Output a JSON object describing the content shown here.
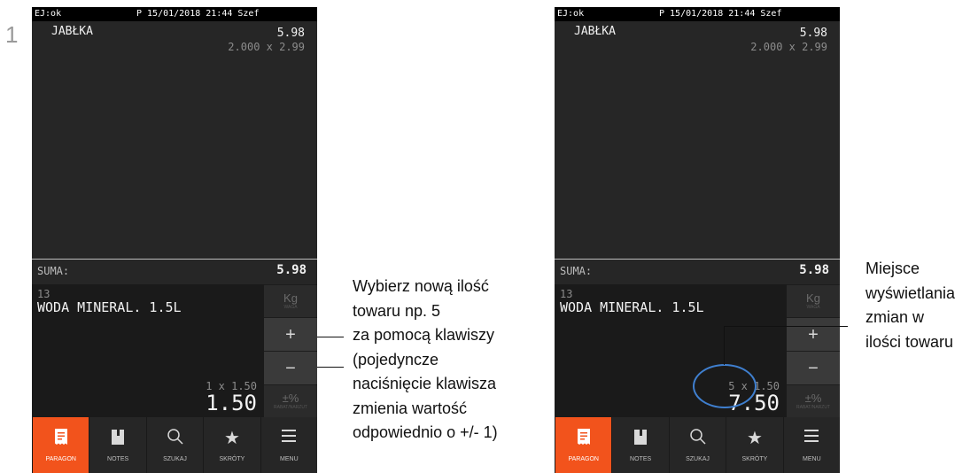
{
  "step_number": "1",
  "device": {
    "status_ej": "EJ:ok",
    "status_info": "P 15/01/2018 21:44 Szef",
    "receipt_item_name": "JABŁKA",
    "receipt_item_total": "5.98",
    "receipt_item_qty": "2.000 x 2.99",
    "sum_label": "SUMA:",
    "sum_value": "5.98",
    "entry_plu": "13",
    "entry_product": "WODA MINERAL. 1.5L",
    "side_kg_label": "Kg",
    "side_kg_sub": "WAGA",
    "side_plus": "+",
    "side_minus": "−",
    "side_pct_label": "±%",
    "side_pct_sub": "RABAT/NARZUT",
    "nav": [
      {
        "label": "PARAGON",
        "icon": "receipt-icon"
      },
      {
        "label": "NOTES",
        "icon": "notebook-icon"
      },
      {
        "label": "SZUKAJ",
        "icon": "search-icon"
      },
      {
        "label": "SKRÓTY",
        "icon": "star-icon"
      },
      {
        "label": "MENU",
        "icon": "menu-icon"
      }
    ]
  },
  "left_screen": {
    "qty_line": "1 x 1.50",
    "price": "1.50"
  },
  "right_screen": {
    "qty_line": "5 x 1.50",
    "price": "7.50"
  },
  "callout_left": [
    "Wybierz nową ilość",
    "towaru np. 5",
    "za pomocą klawiszy",
    "(pojedyncze",
    "naciśnięcie klawisza",
    "zmienia wartość",
    "odpowiednio o +/- 1)"
  ],
  "callout_right": [
    "Miejsce",
    "wyświetlania",
    "zmian w",
    "ilości towaru"
  ],
  "colors": {
    "accent": "#f2531c",
    "highlight": "#3f7fcf"
  }
}
